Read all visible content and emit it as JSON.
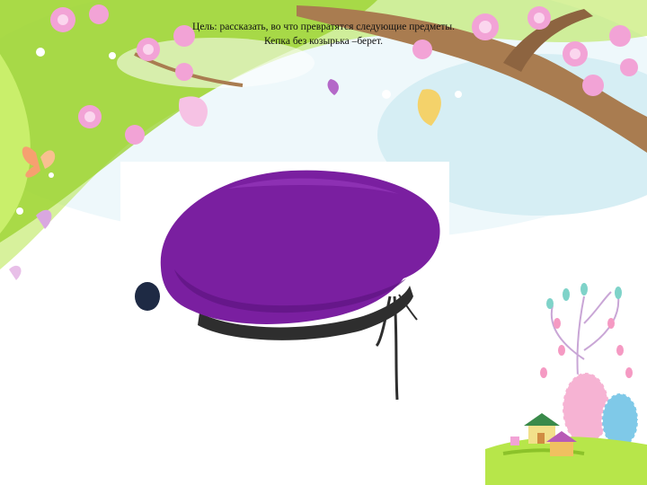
{
  "slide": {
    "goal_line": "Цель: рассказать, во что превратятся следующие предметы.",
    "riddle_line": "Кепка без козырька –берет."
  },
  "colors": {
    "beret": "#7a1fa0",
    "band": "#2e2e2e",
    "leaf_green": "#9ad12b",
    "blossom_pink": "#f2a3d6",
    "sky_blue": "#bfe4ee",
    "branch_brown": "#a97c50"
  },
  "icons": [
    "blossom-branch-icon",
    "butterfly-icon",
    "easter-eggs-icon",
    "house-icon",
    "beret-image"
  ]
}
